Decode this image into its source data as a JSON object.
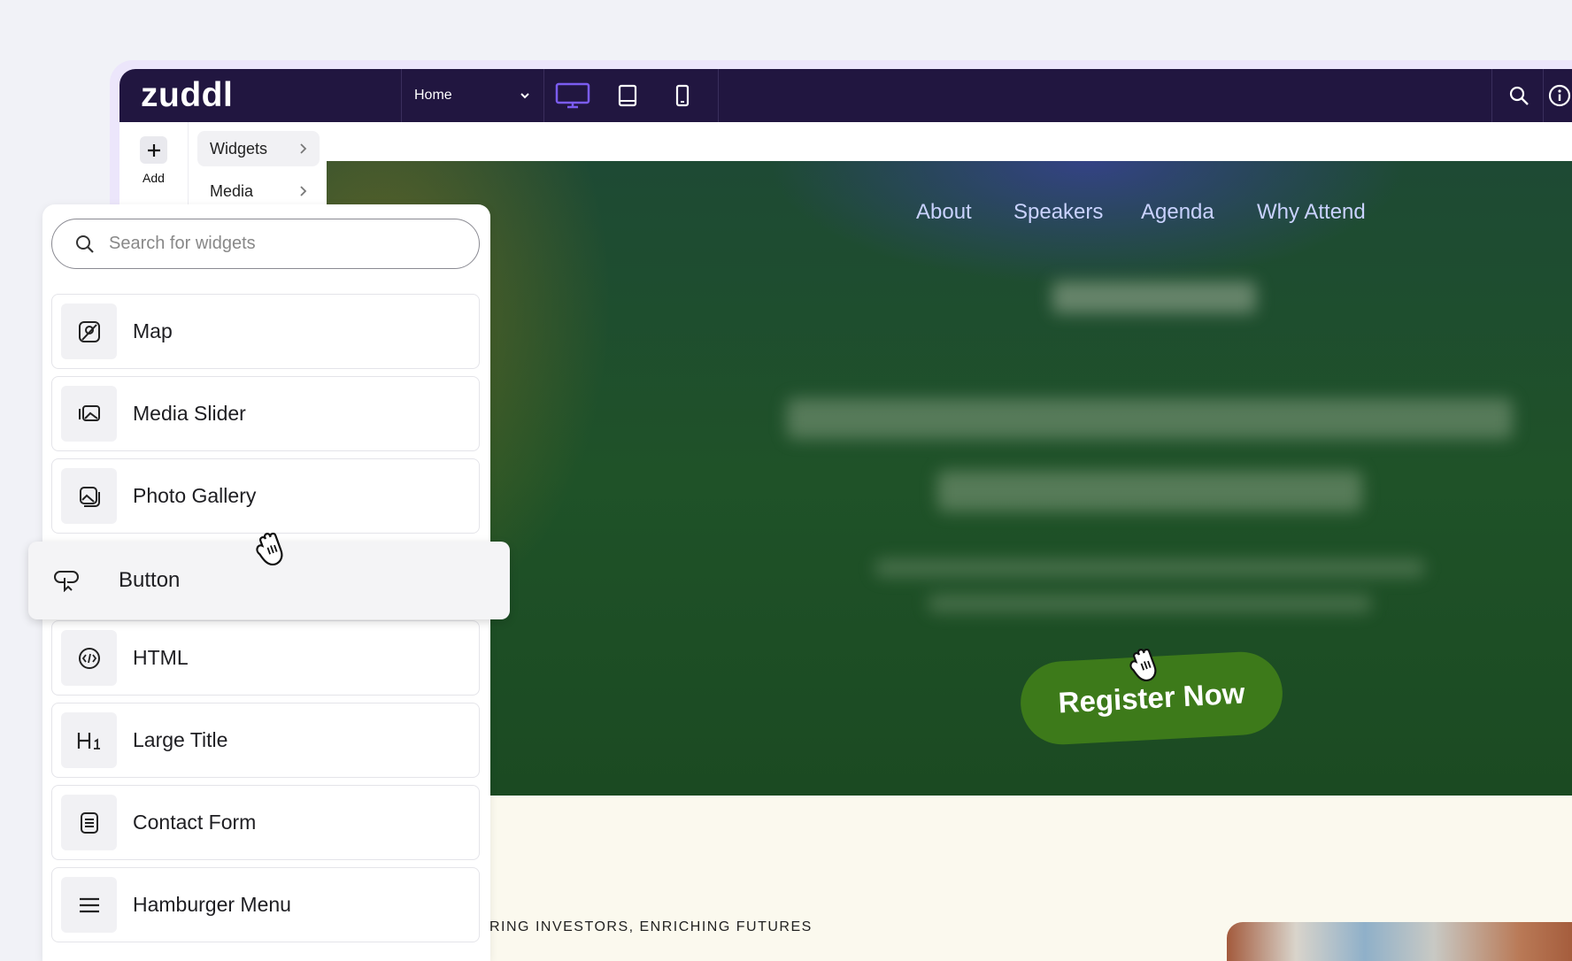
{
  "app": {
    "logo": "zuddl",
    "page_select": {
      "value": "Home"
    },
    "devices": [
      "desktop-icon",
      "tablet-icon",
      "mobile-icon"
    ],
    "right_icons": [
      "search-icon",
      "info-icon"
    ],
    "accent_color": "#7b5cf0",
    "topbar_color": "#211640"
  },
  "sidebar": {
    "add_label": "Add",
    "categories": [
      {
        "label": "Widgets",
        "active": true
      },
      {
        "label": "Media",
        "active": false
      }
    ]
  },
  "widget_panel": {
    "search_placeholder": "Search for widgets",
    "items": [
      {
        "label": "Map",
        "icon": "map-icon"
      },
      {
        "label": "Media Slider",
        "icon": "media-slider-icon"
      },
      {
        "label": "Photo Gallery",
        "icon": "photo-gallery-icon"
      },
      {
        "label": "HTML",
        "icon": "html-code-icon"
      },
      {
        "label": "Large Title",
        "icon": "large-title-icon"
      },
      {
        "label": "Contact Form",
        "icon": "contact-form-icon"
      },
      {
        "label": "Hamburger Menu",
        "icon": "hamburger-menu-icon"
      }
    ],
    "dragging_item": {
      "label": "Button",
      "icon": "button-icon"
    }
  },
  "site": {
    "nav": [
      "About",
      "Speakers",
      "Agenda",
      "Why Attend"
    ],
    "hero_cta": "Register Now",
    "hero_color": "#1f5228",
    "cta_color": "#3d7a1a",
    "tagline": "RING INVESTORS, ENRICHING FUTURES"
  }
}
